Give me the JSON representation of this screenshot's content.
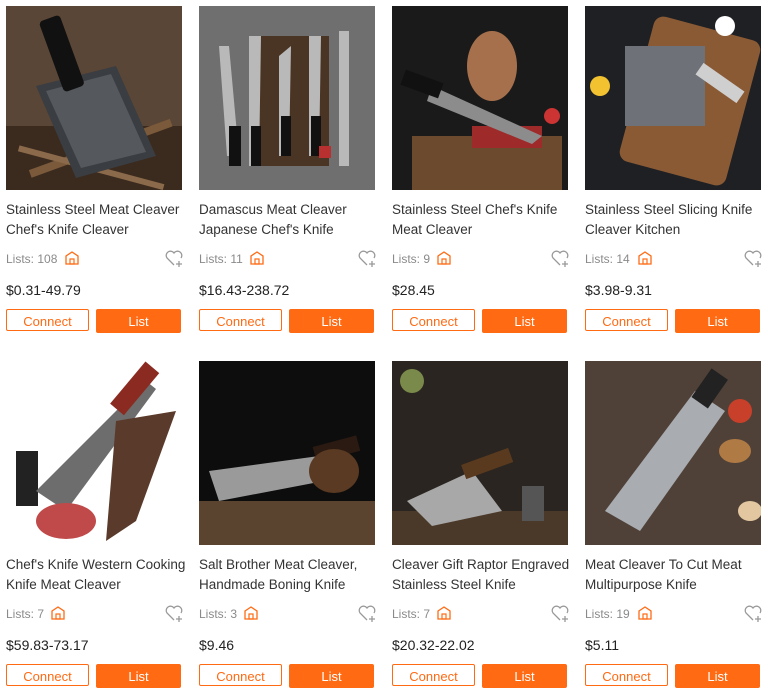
{
  "products": [
    {
      "title": "Stainless Steel Meat Cleaver Chef's Knife Cleaver",
      "lists": "Lists: 108",
      "price": "$0.31-49.79",
      "connect": "Connect",
      "list": "List"
    },
    {
      "title": "Damascus Meat Cleaver Japanese Chef's Knife",
      "lists": "Lists: 11",
      "price": "$16.43-238.72",
      "connect": "Connect",
      "list": "List"
    },
    {
      "title": "Stainless Steel Chef's Knife Meat Cleaver",
      "lists": "Lists: 9",
      "price": "$28.45",
      "connect": "Connect",
      "list": "List"
    },
    {
      "title": "Stainless Steel Slicing Knife Cleaver Kitchen",
      "lists": "Lists: 14",
      "price": "$3.98-9.31",
      "connect": "Connect",
      "list": "List"
    },
    {
      "title": "Chef's Knife Western Cooking Knife Meat Cleaver",
      "lists": "Lists: 7",
      "price": "$59.83-73.17",
      "connect": "Connect",
      "list": "List"
    },
    {
      "title": "Salt Brother Meat Cleaver, Handmade Boning Knife",
      "lists": "Lists: 3",
      "price": "$9.46",
      "connect": "Connect",
      "list": "List"
    },
    {
      "title": "Cleaver Gift Raptor Engraved Stainless Steel Knife",
      "lists": "Lists: 7",
      "price": "$20.32-22.02",
      "connect": "Connect",
      "list": "List"
    },
    {
      "title": "Meat Cleaver To Cut Meat Multipurpose Knife",
      "lists": "Lists: 19",
      "price": "$5.11",
      "connect": "Connect",
      "list": "List"
    }
  ],
  "colors": {
    "accent": "#ff6a13",
    "text": "#333333",
    "muted": "#8a8a8a"
  },
  "icons": {
    "store": "store-icon",
    "favorite": "heart-plus-icon"
  }
}
